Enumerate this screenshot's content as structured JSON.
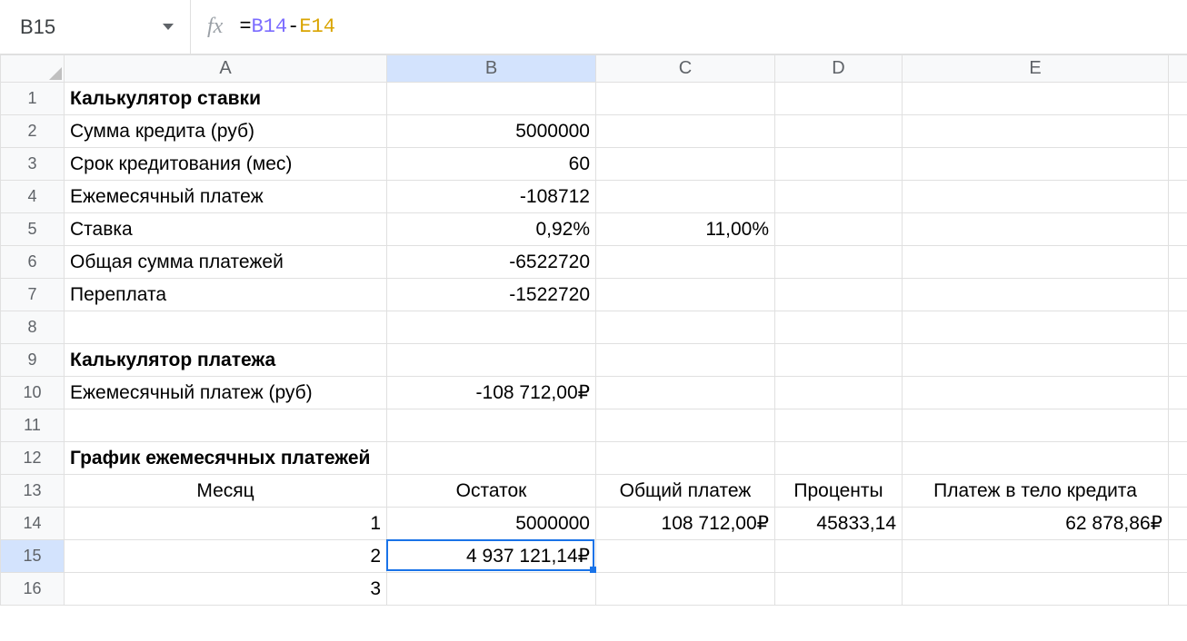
{
  "nameBox": "B15",
  "formula": {
    "eq": "=",
    "ref1": "B14",
    "op": "-",
    "ref2": "E14"
  },
  "columns": [
    "A",
    "B",
    "C",
    "D",
    "E",
    ""
  ],
  "rowCount": 16,
  "selectedCell": {
    "row": 15,
    "col": "B"
  },
  "cells": {
    "A1": {
      "v": "Калькулятор ставки",
      "align": "left",
      "bold": true
    },
    "A2": {
      "v": "Сумма кредита (руб)",
      "align": "left"
    },
    "B2": {
      "v": "5000000",
      "align": "right"
    },
    "A3": {
      "v": "Срок кредитования (мес)",
      "align": "left"
    },
    "B3": {
      "v": "60",
      "align": "right"
    },
    "A4": {
      "v": "Ежемесячный платеж",
      "align": "left"
    },
    "B4": {
      "v": "-108712",
      "align": "right"
    },
    "A5": {
      "v": "Ставка",
      "align": "left"
    },
    "B5": {
      "v": "0,92%",
      "align": "right"
    },
    "C5": {
      "v": "11,00%",
      "align": "right"
    },
    "A6": {
      "v": "Общая сумма платежей",
      "align": "left"
    },
    "B6": {
      "v": "-6522720",
      "align": "right"
    },
    "A7": {
      "v": "Переплата",
      "align": "left"
    },
    "B7": {
      "v": "-1522720",
      "align": "right"
    },
    "A9": {
      "v": "Калькулятор платежа",
      "align": "left",
      "bold": true
    },
    "A10": {
      "v": "Ежемесячный платеж (руб)",
      "align": "left"
    },
    "B10": {
      "v": "-108 712,00₽",
      "align": "right"
    },
    "A12": {
      "v": "График ежемесячных платежей",
      "align": "left",
      "bold": true
    },
    "A13": {
      "v": "Месяц",
      "align": "center"
    },
    "B13": {
      "v": "Остаток",
      "align": "center"
    },
    "C13": {
      "v": "Общий платеж",
      "align": "center"
    },
    "D13": {
      "v": "Проценты",
      "align": "center"
    },
    "E13": {
      "v": "Платеж в тело кредита",
      "align": "center"
    },
    "A14": {
      "v": "1",
      "align": "right"
    },
    "B14": {
      "v": "5000000",
      "align": "right"
    },
    "C14": {
      "v": "108 712,00₽",
      "align": "right"
    },
    "D14": {
      "v": "45833,14",
      "align": "right"
    },
    "E14": {
      "v": "62 878,86₽",
      "align": "right"
    },
    "A15": {
      "v": "2",
      "align": "right"
    },
    "B15": {
      "v": "4 937 121,14₽",
      "align": "right"
    },
    "A16": {
      "v": "3",
      "align": "right"
    }
  }
}
